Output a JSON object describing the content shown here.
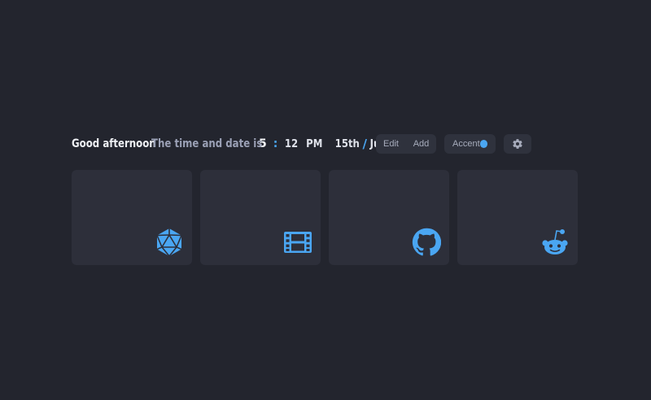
{
  "header": {
    "greeting": "Good afternoon",
    "datetime_intro": "The time and date is",
    "clock": {
      "hour": "5",
      "separator": ":",
      "minute": "12",
      "ampm": "PM"
    },
    "date": {
      "day": "15th",
      "separator": "/",
      "month": "June"
    }
  },
  "controls": {
    "edit_label": "Edit",
    "add_label": "Add",
    "accent_label": "Accent",
    "accent_color": "#4aa6f2",
    "settings_icon": "gear-icon"
  },
  "cards": [
    {
      "icon": "d20-dice-icon"
    },
    {
      "icon": "film-icon"
    },
    {
      "icon": "github-icon"
    },
    {
      "icon": "reddit-icon"
    }
  ],
  "colors": {
    "background": "#23252e",
    "card": "#2d2f3a",
    "accent": "#4aa6f2"
  }
}
